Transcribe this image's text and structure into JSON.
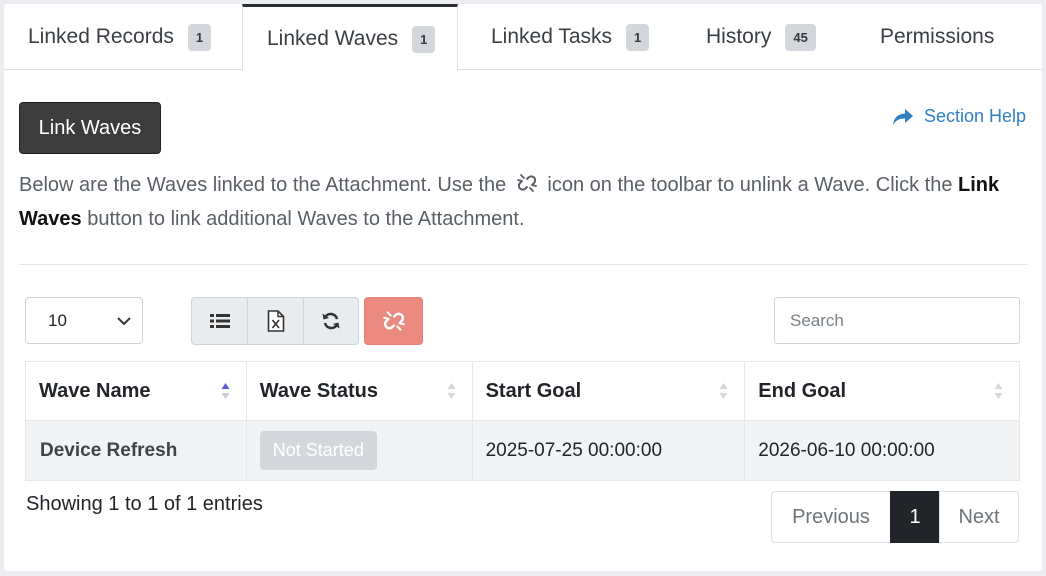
{
  "tabs": [
    {
      "label": "Linked Records",
      "count": "1"
    },
    {
      "label": "Linked Waves",
      "count": "1"
    },
    {
      "label": "Linked Tasks",
      "count": "1"
    },
    {
      "label": "History",
      "count": "45"
    },
    {
      "label": "Permissions"
    }
  ],
  "actions": {
    "link_waves_label": "Link Waves",
    "section_help_label": "Section Help"
  },
  "description": {
    "part1": "Below are the Waves linked to the Attachment. Use the",
    "part2": "icon on the toolbar to unlink a Wave. Click the",
    "bold": "Link Waves",
    "part3": "button to link additional Waves to the Attachment."
  },
  "toolbar": {
    "page_length": "10",
    "search_placeholder": "Search",
    "icons": [
      "list-icon",
      "excel-icon",
      "refresh-icon",
      "unlink-icon"
    ]
  },
  "table": {
    "columns": [
      "Wave Name",
      "Wave Status",
      "Start Goal",
      "End Goal"
    ],
    "rows": [
      {
        "name": "Device Refresh",
        "status": "Not Started",
        "start": "2025-07-25 00:00:00",
        "end": "2026-06-10 00:00:00"
      }
    ]
  },
  "footer": {
    "info": "Showing 1 to 1 of 1 entries",
    "previous": "Previous",
    "page": "1",
    "next": "Next"
  },
  "colors": {
    "accent_link": "#2f7fc1",
    "unlink_button": "#ea8a80",
    "primary_button": "#3c3c3c"
  }
}
